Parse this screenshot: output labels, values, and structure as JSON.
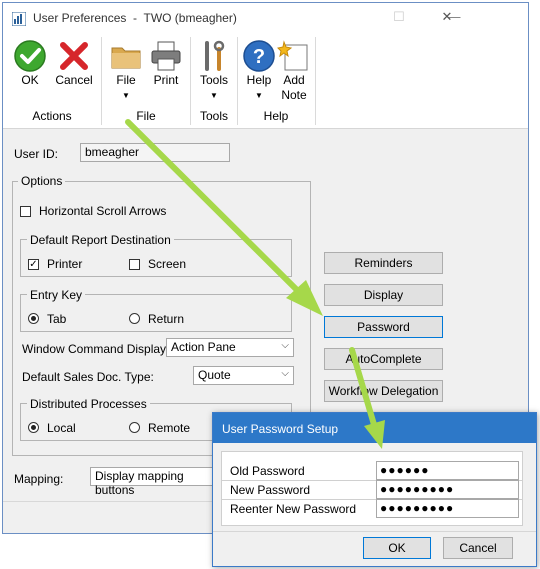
{
  "window": {
    "title": "User Preferences  -  TWO (bmeagher)",
    "controls": [
      "—",
      "☐",
      "✕"
    ]
  },
  "ribbon": {
    "groups": [
      {
        "label": "Actions",
        "buttons": [
          {
            "label": "OK",
            "icon": "ok-check-icon"
          },
          {
            "label": "Cancel",
            "icon": "cancel-x-icon"
          }
        ]
      },
      {
        "label": "File",
        "buttons": [
          {
            "label": "File",
            "icon": "folder-icon",
            "dropdown": true
          },
          {
            "label": "Print",
            "icon": "printer-icon"
          }
        ]
      },
      {
        "label": "Tools",
        "buttons": [
          {
            "label": "Tools",
            "icon": "tools-icon",
            "dropdown": true
          }
        ]
      },
      {
        "label": "Help",
        "buttons": [
          {
            "label": "Help",
            "icon": "help-icon",
            "dropdown": true
          },
          {
            "label": "Add",
            "label2": "Note",
            "icon": "add-note-icon"
          }
        ]
      }
    ]
  },
  "form": {
    "user_id_label": "User ID:",
    "user_id_value": "bmeagher",
    "options_label": "Options",
    "horizontal_scroll_label": "Horizontal Scroll Arrows",
    "horizontal_scroll_checked": false,
    "report_dest_label": "Default Report Destination",
    "printer_label": "Printer",
    "printer_checked": true,
    "screen_label": "Screen",
    "screen_checked": false,
    "entry_key_label": "Entry Key",
    "tab_label": "Tab",
    "return_label": "Return",
    "entry_key_selected": "Tab",
    "window_cmd_label": "Window Command Display",
    "window_cmd_value": "Action Pane",
    "sales_doc_label": "Default Sales Doc. Type:",
    "sales_doc_value": "Quote",
    "distributed_label": "Distributed Processes",
    "local_label": "Local",
    "remote_label": "Remote",
    "distributed_selected": "Local",
    "mapping_label": "Mapping:",
    "mapping_value": "Display mapping buttons"
  },
  "side_buttons": {
    "reminders": "Reminders",
    "display": "Display",
    "password": "Password",
    "autocomplete": "AutoComplete",
    "workflow": "Workflow Delegation"
  },
  "dialog": {
    "title": "User Password Setup",
    "old_password_label": "Old Password",
    "old_password_value": "●●●●●●",
    "new_password_label": "New Password",
    "new_password_value": "●●●●●●●●●",
    "reenter_label": "Reenter New Password",
    "reenter_value": "●●●●●●●●●",
    "ok_label": "OK",
    "cancel_label": "Cancel"
  },
  "colors": {
    "annotation_arrow": "#a6d84a",
    "dialog_titlebar": "#2d78c8",
    "focus_border": "#0078d7"
  }
}
